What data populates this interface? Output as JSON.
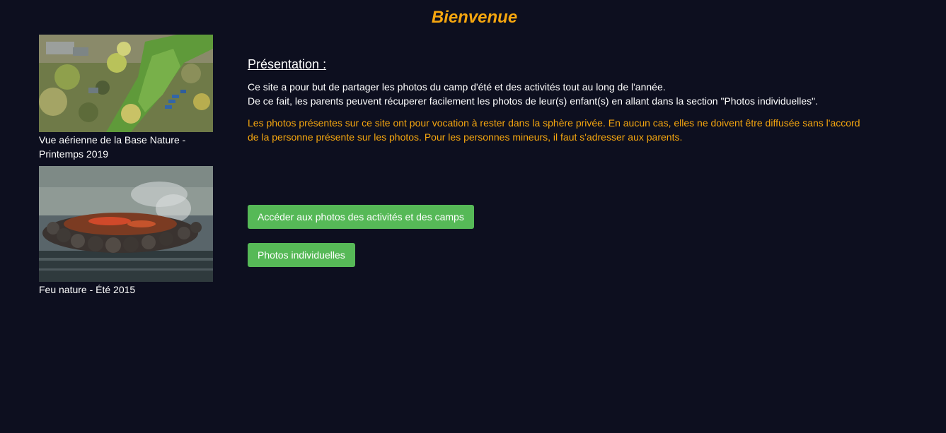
{
  "header": {
    "title": "Bienvenue"
  },
  "gallery": {
    "items": [
      {
        "caption": "Vue aérienne de la Base Nature - Printemps 2019"
      },
      {
        "caption": "Feu nature - Été 2015"
      }
    ]
  },
  "presentation": {
    "heading": "Présentation :",
    "line1": "Ce site a pour but de partager les photos du camp d'été et des activités tout au long de l'année.",
    "line2": "De ce fait, les parents peuvent récuperer facilement les photos de leur(s) enfant(s) en allant dans la section \"Photos individuelles\".",
    "warning": "Les photos présentes sur ce site ont pour vocation à rester dans la sphère privée. En aucun cas, elles ne doivent être diffusée sans l'accord de la personne présente sur les photos. Pour les personnes mineurs, il faut s'adresser aux parents."
  },
  "actions": {
    "activities_label": "Accéder aux photos des activités et des camps",
    "individual_label": "Photos individuelles"
  },
  "colors": {
    "background": "#0d0f1f",
    "accent": "#f5a60f",
    "button": "#56b957"
  }
}
